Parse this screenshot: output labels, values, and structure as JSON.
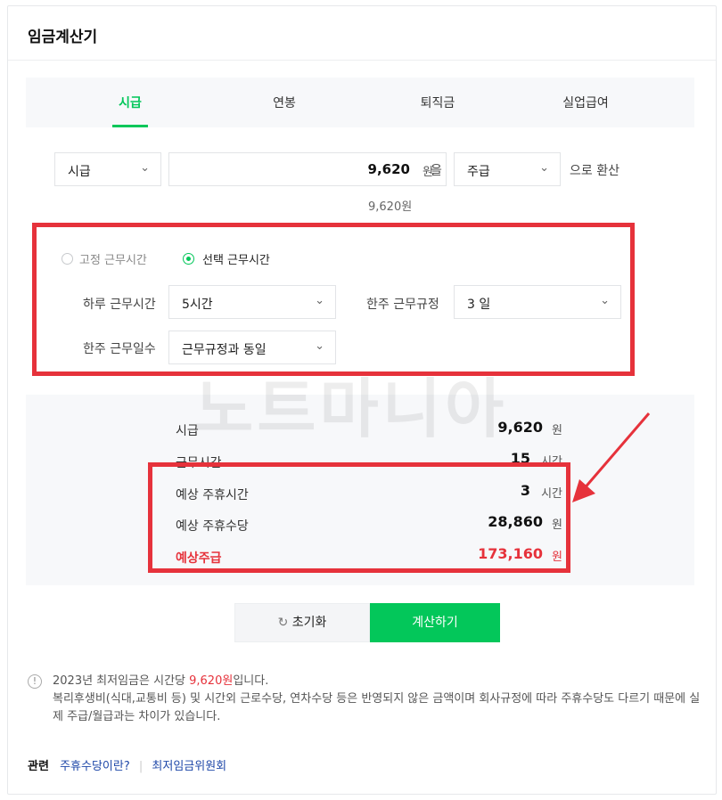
{
  "header": {
    "title": "임금계산기"
  },
  "tabs": [
    "시급",
    "연봉",
    "퇴직금",
    "실업급여"
  ],
  "conversion": {
    "from_select": "시급",
    "amount": "9,620",
    "amount_unit": "원",
    "particle": "을",
    "to_select": "주급",
    "suffix": "으로 환산",
    "hint": "9,620원"
  },
  "work_time": {
    "radio_fixed": "고정 근무시간",
    "radio_select": "선택 근무시간",
    "daily_label": "하루 근무시간",
    "daily_value": "5시간",
    "weekly_rule_label": "한주 근무규정",
    "weekly_rule_value": "3 일",
    "weekly_days_label": "한주 근무일수",
    "weekly_days_value": "근무규정과 동일"
  },
  "results": {
    "hourly_label": "시급",
    "hourly_value": "9,620",
    "hourly_unit": "원",
    "hours_label": "근무시간",
    "hours_value": "15",
    "hours_unit": "시간",
    "holiday_hours_label": "예상 주휴시간",
    "holiday_hours_value": "3",
    "holiday_hours_unit": "시간",
    "holiday_pay_label": "예상 주휴수당",
    "holiday_pay_value": "28,860",
    "holiday_pay_unit": "원",
    "weekly_pay_label": "예상주급",
    "weekly_pay_value": "173,160",
    "weekly_pay_unit": "원"
  },
  "watermark": "노트마니아",
  "buttons": {
    "reset": "초기화",
    "calc": "계산하기"
  },
  "notes": {
    "line1_prefix": "2023년 최저임금은 시간당 ",
    "line1_highlight": "9,620원",
    "line1_suffix": "입니다.",
    "line2": "복리후생비(식대,교통비 등) 및 시간외 근로수당, 연차수당 등은 반영되지 않은 금액이며 회사규정에 따라 주휴수당도 다르기 때문에 실제 주급/월급과는 차이가 있습니다."
  },
  "related": {
    "label": "관련",
    "links": [
      "주휴수당이란?",
      "최저임금위원회"
    ]
  },
  "colors": {
    "accent": "#03c75a",
    "highlight": "#e6323b"
  }
}
